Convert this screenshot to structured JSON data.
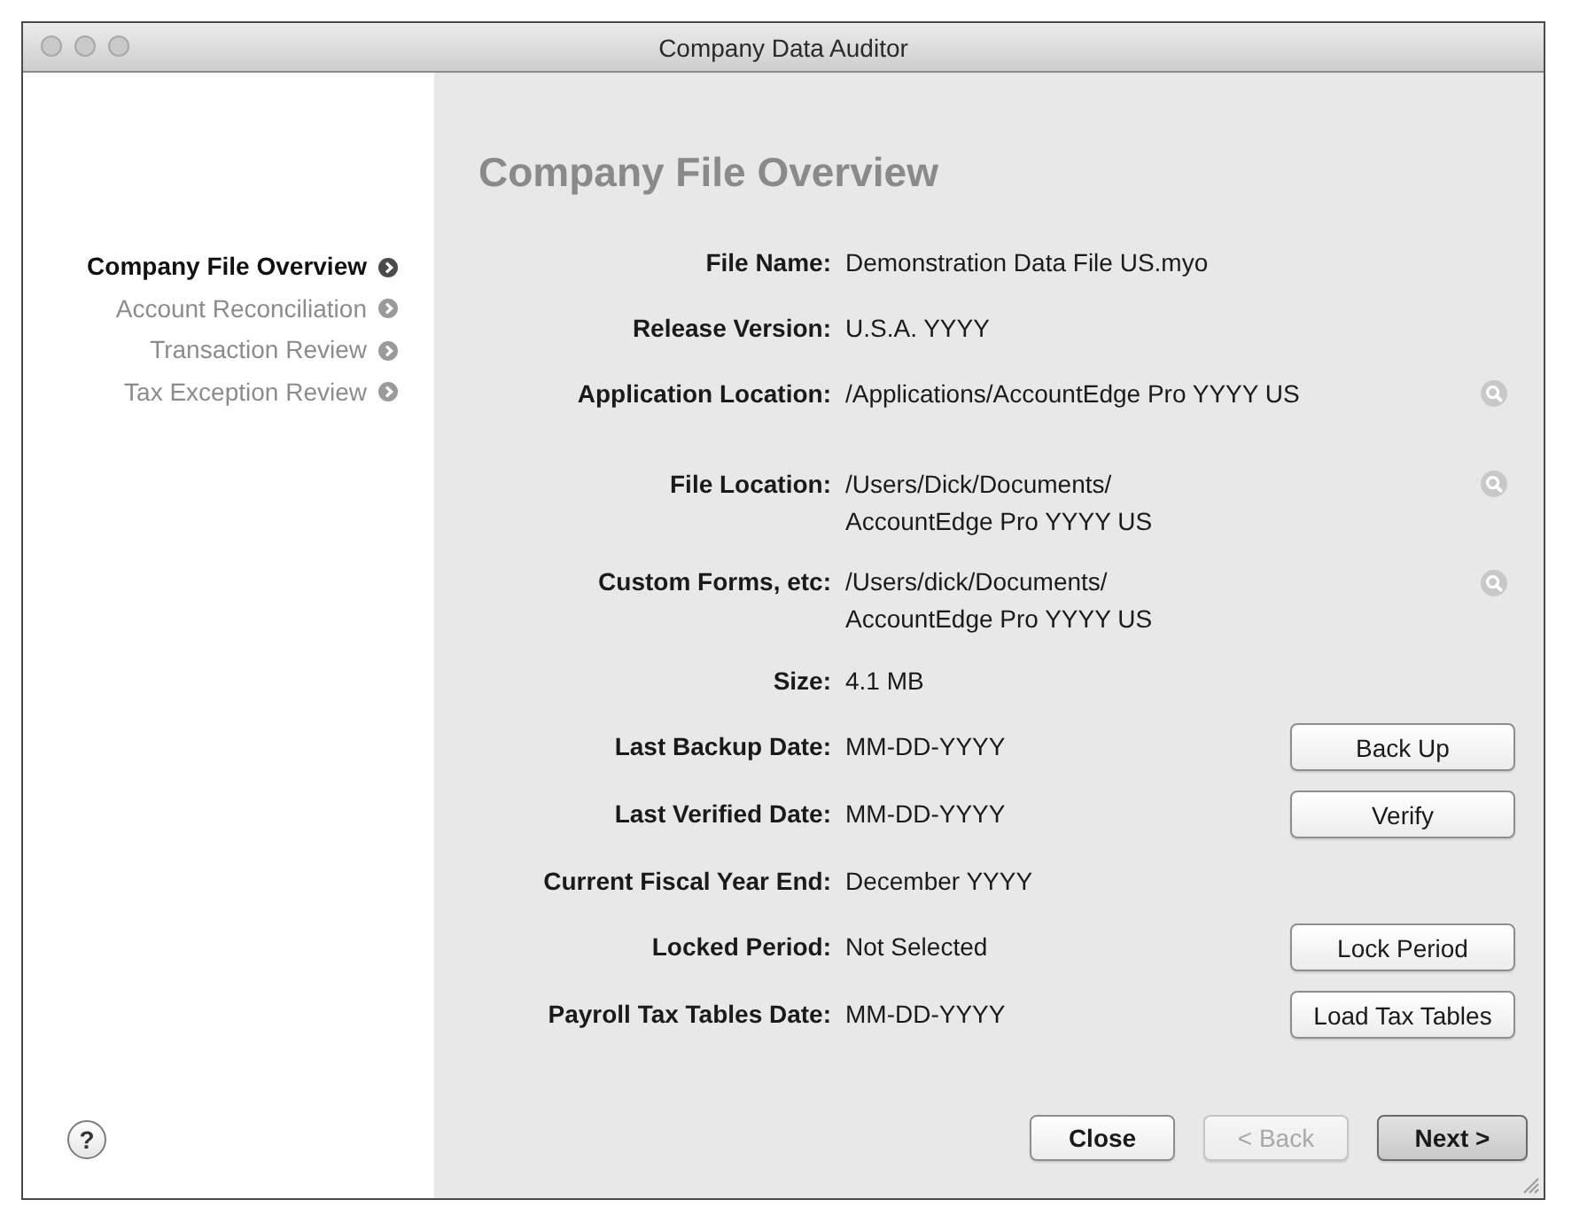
{
  "window": {
    "title": "Company Data Auditor"
  },
  "sidebar": {
    "items": [
      {
        "label": "Company File Overview",
        "selected": true
      },
      {
        "label": "Account Reconciliation",
        "selected": false
      },
      {
        "label": "Transaction Review",
        "selected": false
      },
      {
        "label": "Tax Exception Review",
        "selected": false
      }
    ],
    "help_button": "?"
  },
  "page": {
    "heading": "Company File Overview",
    "fields": [
      {
        "label": "File Name:",
        "value": [
          "Demonstration Data File US.myo"
        ]
      },
      {
        "label": "Release Version:",
        "value": [
          "U.S.A. YYYY"
        ]
      },
      {
        "label": "Application Location:",
        "value": [
          "/Applications/AccountEdge Pro YYYY US"
        ],
        "action": {
          "kind": "reveal"
        }
      },
      {
        "label": "File Location:",
        "value": [
          "/Users/Dick/Documents/",
          "AccountEdge Pro YYYY US"
        ],
        "action": {
          "kind": "reveal"
        }
      },
      {
        "label": "Custom Forms, etc:",
        "value": [
          "/Users/dick/Documents/",
          "AccountEdge Pro YYYY US"
        ],
        "action": {
          "kind": "reveal"
        }
      },
      {
        "label": "Size:",
        "value": [
          "4.1 MB"
        ]
      },
      {
        "label": "Last Backup Date:",
        "value": [
          "MM-DD-YYYY"
        ],
        "action": {
          "kind": "button",
          "label": "Back Up"
        }
      },
      {
        "label": "Last Verified Date:",
        "value": [
          "MM-DD-YYYY"
        ],
        "action": {
          "kind": "button",
          "label": "Verify"
        }
      },
      {
        "label": "Current Fiscal Year End:",
        "value": [
          "December YYYY"
        ]
      },
      {
        "label": "Locked Period:",
        "value": [
          "Not Selected"
        ],
        "action": {
          "kind": "button",
          "label": "Lock Period"
        }
      },
      {
        "label": "Payroll Tax Tables Date:",
        "value": [
          "MM-DD-YYYY"
        ],
        "action": {
          "kind": "button",
          "label": "Load Tax Tables"
        }
      }
    ]
  },
  "footer": {
    "buttons": [
      {
        "label": "Close",
        "disabled": false,
        "default": false
      },
      {
        "label": "< Back",
        "disabled": true,
        "default": false
      },
      {
        "label": "Next >",
        "disabled": false,
        "default": true
      }
    ]
  }
}
